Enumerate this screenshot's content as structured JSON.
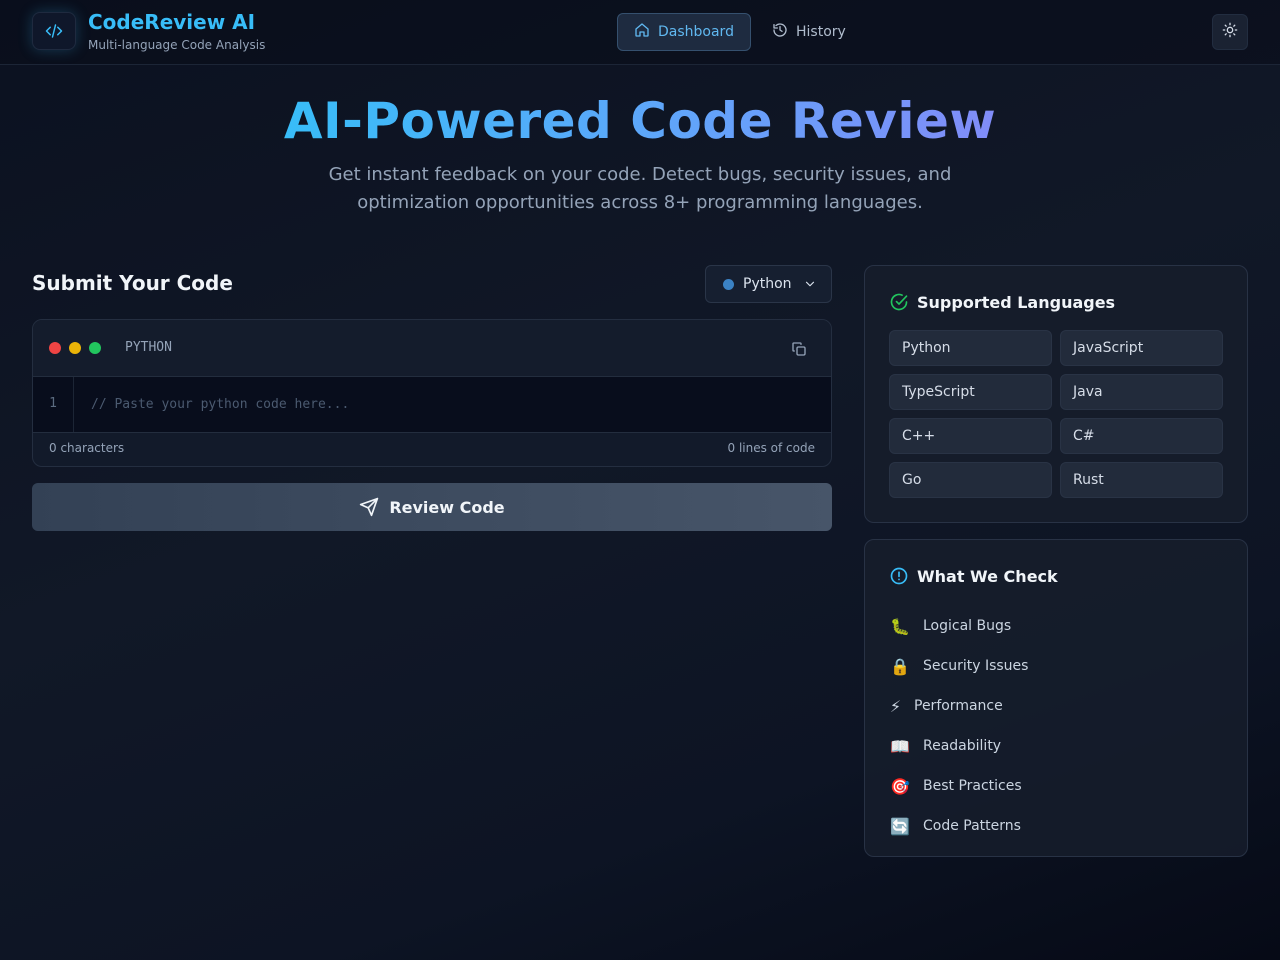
{
  "header": {
    "app_name": "CodeReview AI",
    "app_subtitle": "Multi-language Code Analysis",
    "nav": {
      "dashboard": "Dashboard",
      "history": "History"
    },
    "active_nav": "Dashboard"
  },
  "hero": {
    "title": "AI-Powered Code Review",
    "subtitle": "Get instant feedback on your code. Detect bugs, security issues, and optimization opportunities across 8+ programming languages."
  },
  "submit": {
    "title": "Submit Your Code",
    "selected_language": "Python",
    "editor_language_label": "PYTHON",
    "line_number": "1",
    "code_value": "",
    "code_placeholder": "// Paste your python code here...",
    "char_count": "0 characters",
    "line_count": "0 lines of code",
    "review_button": "Review Code"
  },
  "supported": {
    "title": "Supported Languages",
    "languages": [
      "Python",
      "JavaScript",
      "TypeScript",
      "Java",
      "C++",
      "C#",
      "Go",
      "Rust"
    ]
  },
  "checks": {
    "title": "What We Check",
    "items": [
      {
        "icon": "bug-icon",
        "emoji": "🐛",
        "label": "Logical Bugs"
      },
      {
        "icon": "lock-icon",
        "emoji": "🔒",
        "label": "Security Issues"
      },
      {
        "icon": "lightning-icon",
        "emoji": "⚡",
        "label": "Performance"
      },
      {
        "icon": "book-icon",
        "emoji": "📖",
        "label": "Readability"
      },
      {
        "icon": "target-icon",
        "emoji": "🎯",
        "label": "Best Practices"
      },
      {
        "icon": "cycle-icon",
        "emoji": "🔄",
        "label": "Code Patterns"
      }
    ]
  },
  "colors": {
    "accent": "#38bdf8",
    "accent_purple": "#818cf8",
    "background": "#0b1120",
    "dot_red": "#ef4444",
    "dot_yellow": "#eab308",
    "dot_green": "#22c55e",
    "check_green": "#22c55e"
  }
}
